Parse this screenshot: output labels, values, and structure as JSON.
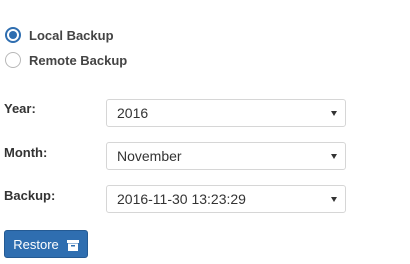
{
  "backup_source": {
    "options": [
      {
        "label": "Local Backup",
        "selected": true
      },
      {
        "label": "Remote Backup",
        "selected": false
      }
    ]
  },
  "form": {
    "year": {
      "label": "Year:",
      "value": "2016"
    },
    "month": {
      "label": "Month:",
      "value": "November"
    },
    "backup": {
      "label": "Backup:",
      "value": "2016-11-30 13:23:29"
    }
  },
  "actions": {
    "restore_label": "Restore",
    "restore_icon": "archive-icon"
  },
  "colors": {
    "accent": "#2f6eb0",
    "text": "#333333",
    "border": "#d6d6d6"
  }
}
